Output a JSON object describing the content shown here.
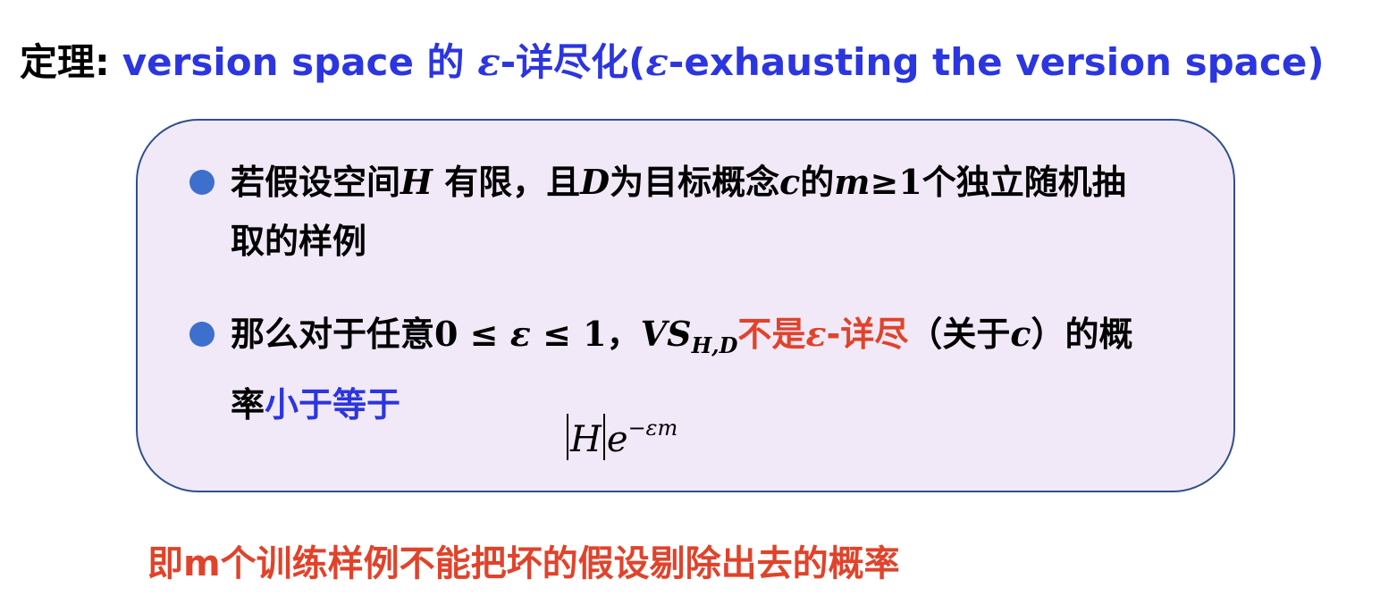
{
  "title": {
    "label": "定理:",
    "text_pre": "version space 的 ",
    "eps": "ε",
    "text_mid": "-详尽化(",
    "eps2": "ε",
    "text_post": "-exhausting the version space)"
  },
  "theorem_box": {
    "bullet1": {
      "t1": "若假设空间",
      "m1": "H",
      "t2": " 有限，且",
      "m2": "D",
      "t3": "为目标概念",
      "m3": "c",
      "t4": "的",
      "m4": "m",
      "m5": "≥1",
      "t5": "个独立随机抽取的样例"
    },
    "bullet2": {
      "t1": "那么对于任意",
      "m1": "0 ≤ ",
      "m2": "ε",
      "m3": " ≤ 1",
      "t2": "，",
      "m4": "VS",
      "m4_sub": "H,D",
      "red1": "不是",
      "red_eps": "ε",
      "red2": "-详尽",
      "t3": "（关于",
      "m5": "c",
      "t4": "）的概率",
      "blue": "小于等于"
    },
    "formula": {
      "h": "H",
      "e": "e",
      "exp": "−εm"
    }
  },
  "footer": {
    "text": "即m个训练样例不能把坏的假设剔除出去的概率"
  },
  "colors": {
    "title_blue": "#2b35e0",
    "red": "#e0432b",
    "box_fill": "#f1e9f7",
    "box_border": "#2e4f8f",
    "bullet_dot": "#3d6fcc"
  }
}
